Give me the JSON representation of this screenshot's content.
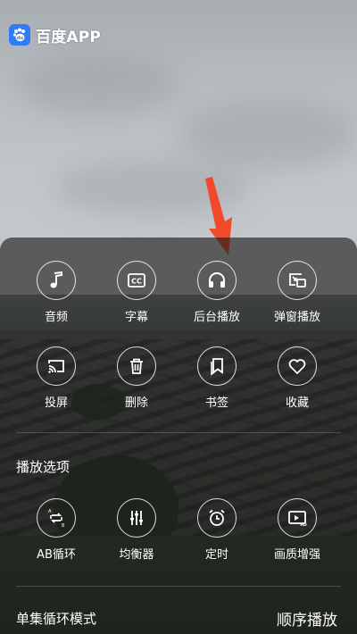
{
  "app_badge": {
    "name": "百度APP",
    "logo_icon": "baidu-paw-icon",
    "logo_color": "#2f7cf6"
  },
  "annotation": {
    "arrow_color": "#f04a2a",
    "points_to": "后台播放"
  },
  "menu": {
    "row1": [
      {
        "label": "音频",
        "icon": "music-note-icon"
      },
      {
        "label": "字幕",
        "icon": "subtitles-cc-icon"
      },
      {
        "label": "后台播放",
        "icon": "headphones-icon"
      },
      {
        "label": "弹窗播放",
        "icon": "picture-in-picture-icon"
      }
    ],
    "row2": [
      {
        "label": "投屏",
        "icon": "cast-icon"
      },
      {
        "label": "删除",
        "icon": "trash-icon"
      },
      {
        "label": "书签",
        "icon": "bookmark-icon"
      },
      {
        "label": "收藏",
        "icon": "heart-icon"
      }
    ],
    "section_title": "播放选项",
    "row3": [
      {
        "label": "AB循环",
        "icon": "ab-loop-icon"
      },
      {
        "label": "均衡器",
        "icon": "equalizer-icon"
      },
      {
        "label": "定时",
        "icon": "alarm-clock-icon"
      },
      {
        "label": "画质增强",
        "icon": "hd-enhance-icon"
      }
    ],
    "footer": {
      "mode_label": "单集循环模式",
      "order_label": "顺序播放"
    }
  }
}
